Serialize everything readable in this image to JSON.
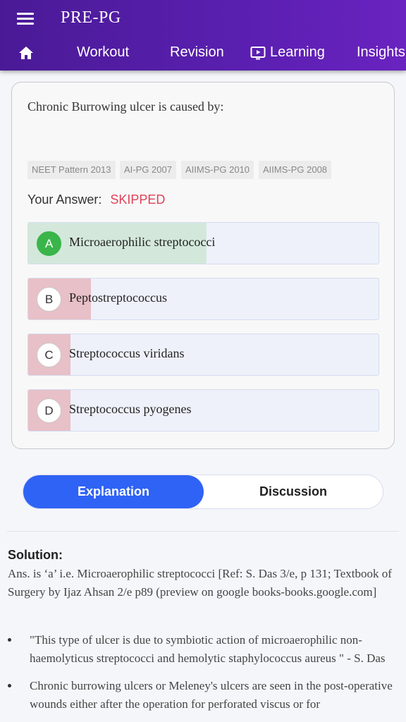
{
  "app": {
    "title": "PRE-PG",
    "tabs": [
      {
        "icon": "home-icon"
      },
      {
        "label": "Workout"
      },
      {
        "label": "Revision"
      },
      {
        "label": "Learning",
        "icon": "play-screen-icon"
      },
      {
        "label": "Insights"
      }
    ]
  },
  "question": {
    "text": "Chronic Burrowing ulcer is caused by:",
    "tags": [
      "NEET Pattern 2013",
      "AI-PG 2007",
      "AIIMS-PG 2010",
      "AIIMS-PG 2008"
    ],
    "your_answer_label": "Your Answer:",
    "your_answer_value": "SKIPPED",
    "options": [
      {
        "letter": "A",
        "text": "Microaerophilic streptococci",
        "correct": true,
        "bar_percent": 51
      },
      {
        "letter": "B",
        "text": "Peptostreptococcus",
        "correct": false,
        "bar_percent": 18
      },
      {
        "letter": "C",
        "text": "Streptococcus viridans",
        "correct": false,
        "bar_percent": 12
      },
      {
        "letter": "D",
        "text": "Streptococcus pyogenes",
        "correct": false,
        "bar_percent": 12
      }
    ]
  },
  "switcher": {
    "explanation": "Explanation",
    "discussion": "Discussion"
  },
  "solution": {
    "heading": "Solution:",
    "text": "Ans. is ‘a’ i.e. Microaerophilic streptococci [Ref: S. Das 3/e, p 131; Textbook of Surgery by Ijaz Ahsan 2/e p89 (preview on google books-books.google.com]",
    "bullets": [
      "\"This type of ulcer is due to symbiotic action of microaerophilic non-haemolyticus streptococci and hemolytic staphylococcus aureus \" - S. Das",
      "Chronic burrowing ulcers or Meleney's ulcers are seen in the post-operative wounds either after the operation for perforated viscus or for"
    ]
  },
  "colors": {
    "appbar": "#5a1fb0",
    "correct_fill": "#d3e8db",
    "wrong_fill": "#e8c0c7",
    "correct_badge": "#3ab54a",
    "skipped": "#e04258",
    "active_tab": "#2f63f5"
  }
}
